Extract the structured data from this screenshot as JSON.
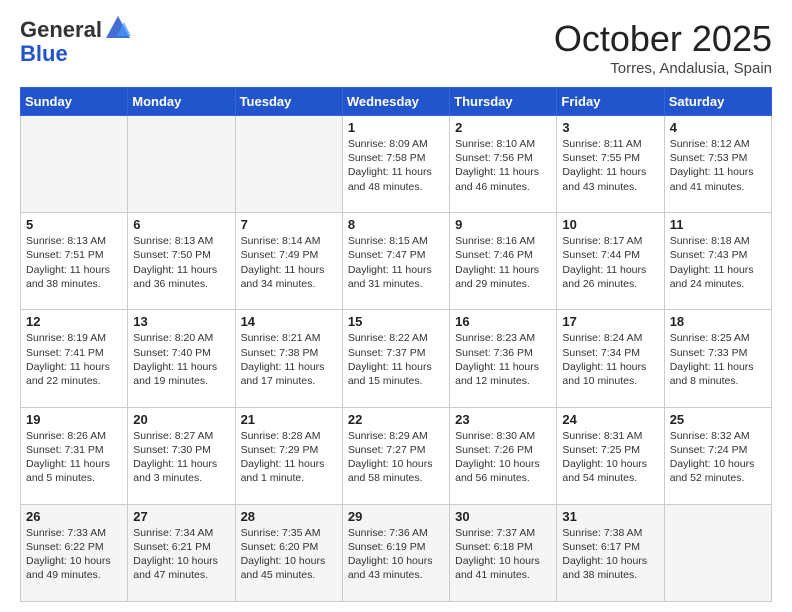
{
  "logo": {
    "general": "General",
    "blue": "Blue"
  },
  "header": {
    "month": "October 2025",
    "location": "Torres, Andalusia, Spain"
  },
  "weekdays": [
    "Sunday",
    "Monday",
    "Tuesday",
    "Wednesday",
    "Thursday",
    "Friday",
    "Saturday"
  ],
  "weeks": [
    [
      {
        "day": "",
        "info": ""
      },
      {
        "day": "",
        "info": ""
      },
      {
        "day": "",
        "info": ""
      },
      {
        "day": "1",
        "info": "Sunrise: 8:09 AM\nSunset: 7:58 PM\nDaylight: 11 hours and 48 minutes."
      },
      {
        "day": "2",
        "info": "Sunrise: 8:10 AM\nSunset: 7:56 PM\nDaylight: 11 hours and 46 minutes."
      },
      {
        "day": "3",
        "info": "Sunrise: 8:11 AM\nSunset: 7:55 PM\nDaylight: 11 hours and 43 minutes."
      },
      {
        "day": "4",
        "info": "Sunrise: 8:12 AM\nSunset: 7:53 PM\nDaylight: 11 hours and 41 minutes."
      }
    ],
    [
      {
        "day": "5",
        "info": "Sunrise: 8:13 AM\nSunset: 7:51 PM\nDaylight: 11 hours and 38 minutes."
      },
      {
        "day": "6",
        "info": "Sunrise: 8:13 AM\nSunset: 7:50 PM\nDaylight: 11 hours and 36 minutes."
      },
      {
        "day": "7",
        "info": "Sunrise: 8:14 AM\nSunset: 7:49 PM\nDaylight: 11 hours and 34 minutes."
      },
      {
        "day": "8",
        "info": "Sunrise: 8:15 AM\nSunset: 7:47 PM\nDaylight: 11 hours and 31 minutes."
      },
      {
        "day": "9",
        "info": "Sunrise: 8:16 AM\nSunset: 7:46 PM\nDaylight: 11 hours and 29 minutes."
      },
      {
        "day": "10",
        "info": "Sunrise: 8:17 AM\nSunset: 7:44 PM\nDaylight: 11 hours and 26 minutes."
      },
      {
        "day": "11",
        "info": "Sunrise: 8:18 AM\nSunset: 7:43 PM\nDaylight: 11 hours and 24 minutes."
      }
    ],
    [
      {
        "day": "12",
        "info": "Sunrise: 8:19 AM\nSunset: 7:41 PM\nDaylight: 11 hours and 22 minutes."
      },
      {
        "day": "13",
        "info": "Sunrise: 8:20 AM\nSunset: 7:40 PM\nDaylight: 11 hours and 19 minutes."
      },
      {
        "day": "14",
        "info": "Sunrise: 8:21 AM\nSunset: 7:38 PM\nDaylight: 11 hours and 17 minutes."
      },
      {
        "day": "15",
        "info": "Sunrise: 8:22 AM\nSunset: 7:37 PM\nDaylight: 11 hours and 15 minutes."
      },
      {
        "day": "16",
        "info": "Sunrise: 8:23 AM\nSunset: 7:36 PM\nDaylight: 11 hours and 12 minutes."
      },
      {
        "day": "17",
        "info": "Sunrise: 8:24 AM\nSunset: 7:34 PM\nDaylight: 11 hours and 10 minutes."
      },
      {
        "day": "18",
        "info": "Sunrise: 8:25 AM\nSunset: 7:33 PM\nDaylight: 11 hours and 8 minutes."
      }
    ],
    [
      {
        "day": "19",
        "info": "Sunrise: 8:26 AM\nSunset: 7:31 PM\nDaylight: 11 hours and 5 minutes."
      },
      {
        "day": "20",
        "info": "Sunrise: 8:27 AM\nSunset: 7:30 PM\nDaylight: 11 hours and 3 minutes."
      },
      {
        "day": "21",
        "info": "Sunrise: 8:28 AM\nSunset: 7:29 PM\nDaylight: 11 hours and 1 minute."
      },
      {
        "day": "22",
        "info": "Sunrise: 8:29 AM\nSunset: 7:27 PM\nDaylight: 10 hours and 58 minutes."
      },
      {
        "day": "23",
        "info": "Sunrise: 8:30 AM\nSunset: 7:26 PM\nDaylight: 10 hours and 56 minutes."
      },
      {
        "day": "24",
        "info": "Sunrise: 8:31 AM\nSunset: 7:25 PM\nDaylight: 10 hours and 54 minutes."
      },
      {
        "day": "25",
        "info": "Sunrise: 8:32 AM\nSunset: 7:24 PM\nDaylight: 10 hours and 52 minutes."
      }
    ],
    [
      {
        "day": "26",
        "info": "Sunrise: 7:33 AM\nSunset: 6:22 PM\nDaylight: 10 hours and 49 minutes."
      },
      {
        "day": "27",
        "info": "Sunrise: 7:34 AM\nSunset: 6:21 PM\nDaylight: 10 hours and 47 minutes."
      },
      {
        "day": "28",
        "info": "Sunrise: 7:35 AM\nSunset: 6:20 PM\nDaylight: 10 hours and 45 minutes."
      },
      {
        "day": "29",
        "info": "Sunrise: 7:36 AM\nSunset: 6:19 PM\nDaylight: 10 hours and 43 minutes."
      },
      {
        "day": "30",
        "info": "Sunrise: 7:37 AM\nSunset: 6:18 PM\nDaylight: 10 hours and 41 minutes."
      },
      {
        "day": "31",
        "info": "Sunrise: 7:38 AM\nSunset: 6:17 PM\nDaylight: 10 hours and 38 minutes."
      },
      {
        "day": "",
        "info": ""
      }
    ]
  ]
}
